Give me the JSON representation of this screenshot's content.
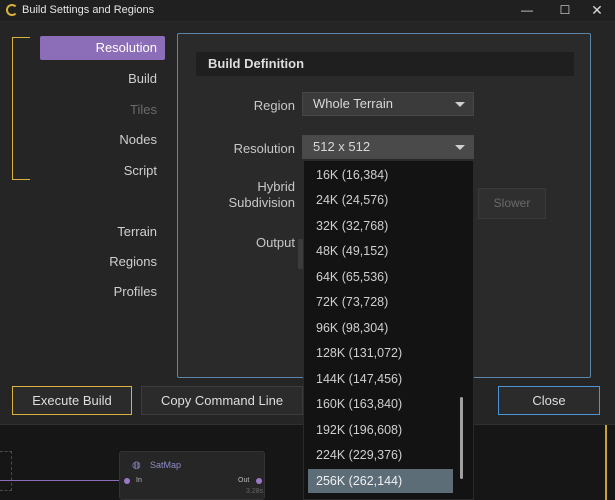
{
  "window": {
    "title": "Build Settings and Regions",
    "minimize": "—",
    "maximize": "☐",
    "close": "✕"
  },
  "sidebar": {
    "items": [
      {
        "label": "Resolution",
        "state": "active"
      },
      {
        "label": "Build",
        "state": "normal"
      },
      {
        "label": "Tiles",
        "state": "disabled"
      },
      {
        "label": "Nodes",
        "state": "normal"
      },
      {
        "label": "Script",
        "state": "normal"
      },
      {
        "label": "Terrain",
        "state": "normal"
      },
      {
        "label": "Regions",
        "state": "normal"
      },
      {
        "label": "Profiles",
        "state": "normal"
      }
    ]
  },
  "build_definition": {
    "header": "Build Definition",
    "region_label": "Region",
    "region_value": "Whole Terrain",
    "resolution_label": "Resolution",
    "resolution_value": "512 x 512",
    "hybrid_label_line1": "Hybrid",
    "hybrid_label_line2": "Subdivision",
    "slower_label": "Slower",
    "output_label": "Output"
  },
  "resolution_dropdown": {
    "options": [
      "16K (16,384)",
      "24K (24,576)",
      "32K (32,768)",
      "48K (49,152)",
      "64K (65,536)",
      "72K (73,728)",
      "96K (98,304)",
      "128K (131,072)",
      "144K (147,456)",
      "160K (163,840)",
      "192K (196,608)",
      "224K (229,376)",
      "256K (262,144)"
    ],
    "highlighted": "256K (262,144)"
  },
  "buttons": {
    "execute": "Execute Build",
    "copy": "Copy Command Line",
    "close": "Close"
  },
  "graph": {
    "node_title": "SatMap",
    "node_in": "In",
    "node_out": "Out",
    "node_time": "3.28s"
  },
  "colors": {
    "accent_purple": "#8c6db8",
    "accent_gold": "#d9b23b",
    "accent_blue": "#4c95d6"
  },
  "icons": {
    "app": "terrain-app-icon",
    "dropdown_caret": "chevron-down-icon",
    "node": "satellite-icon"
  }
}
